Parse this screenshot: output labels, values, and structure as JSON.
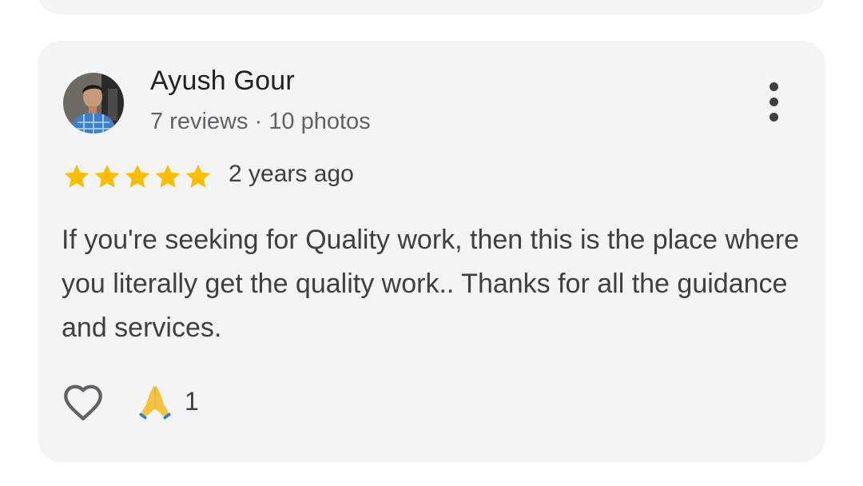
{
  "review": {
    "author_name": "Ayush Gour",
    "author_meta": "7 reviews · 10 photos",
    "avatar_icon": "user-avatar",
    "more_icon": "more-vertical-icon",
    "rating": 5,
    "rating_max": 5,
    "time_ago": "2 years ago",
    "text": "If you're seeking for Quality work, then this is the place where you literally get the quality work.. Thanks for all the guidance and services.",
    "like_icon": "heart-outline-icon",
    "reaction_icon": "folded-hands-emoji",
    "reaction_emoji": "🙏",
    "reaction_count": "1"
  },
  "colors": {
    "card_bg": "#f3f4f6",
    "star": "#fbbc04",
    "primary_text": "#202124",
    "secondary_text": "#5f6368"
  }
}
